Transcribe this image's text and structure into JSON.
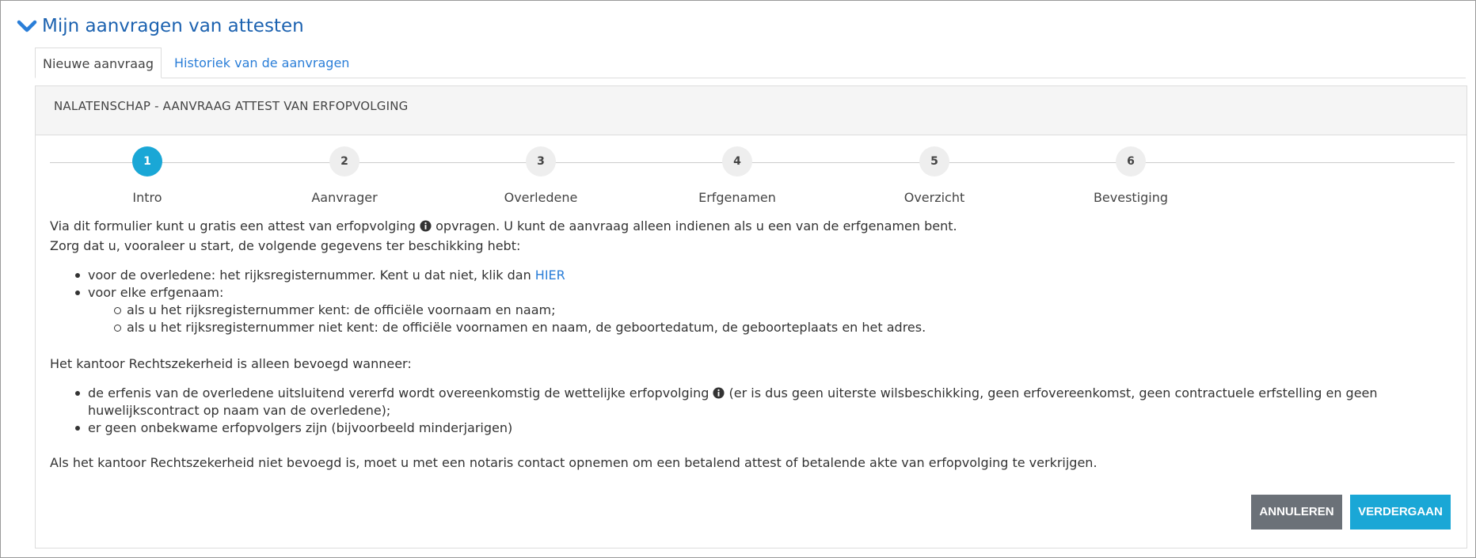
{
  "header": {
    "title": "Mijn aanvragen van attesten",
    "icon": "chevron-down-icon"
  },
  "tabs": [
    {
      "label": "Nieuwe aanvraag",
      "active": true
    },
    {
      "label": "Historiek van de aanvragen",
      "active": false
    }
  ],
  "panel": {
    "title": "NALATENSCHAP - AANVRAAG ATTEST VAN ERFOPVOLGING"
  },
  "steps": [
    {
      "number": "1",
      "label": "Intro",
      "active": true
    },
    {
      "number": "2",
      "label": "Aanvrager",
      "active": false
    },
    {
      "number": "3",
      "label": "Overledene",
      "active": false
    },
    {
      "number": "4",
      "label": "Erfgenamen",
      "active": false
    },
    {
      "number": "5",
      "label": "Overzicht",
      "active": false
    },
    {
      "number": "6",
      "label": "Bevestiging",
      "active": false
    }
  ],
  "intro": {
    "p1_before": "Via dit formulier kunt u gratis een attest van erfopvolging ",
    "p1_after": " opvragen. U kunt de aanvraag alleen indienen als u een van de erfgenamen bent.",
    "p2": "Zorg dat u, vooraleer u start, de volgende gegevens ter beschikking hebt:",
    "item1_text": "voor de overledene: het rijksregisternummer. Kent u dat niet, klik dan ",
    "item1_link": "HIER",
    "item2_text": "voor elke erfgenaam:",
    "sub1": "als u het rijksregisternummer kent: de officiële voornaam en naam;",
    "sub2": "als u het rijksregisternummer niet kent: de officiële voornamen en naam, de geboortedatum, de geboorteplaats en het adres.",
    "p3": "Het kantoor Rechtszekerheid is alleen bevoegd wanneer:",
    "cond1_before": "de erfenis van de overledene uitsluitend vererfd wordt overeenkomstig de wettelijke erfopvolging ",
    "cond1_after": " (er is dus geen uiterste wilsbeschikking, geen erfovereenkomst, geen contractuele erfstelling en geen huwelijkscontract op naam van de overledene);",
    "cond2": "er geen onbekwame erfopvolgers zijn (bijvoorbeeld minderjarigen)",
    "p4": "Als het kantoor Rechtszekerheid niet bevoegd is, moet u met een notaris contact opnemen om een betalend attest of betalende akte van erfopvolging te verkrijgen."
  },
  "buttons": {
    "cancel": "ANNULEREN",
    "next": "VERDERGAAN"
  },
  "colors": {
    "accent": "#1aa7d6",
    "link": "#2a7ed8",
    "title": "#1c62b0",
    "cancel": "#6b7178"
  }
}
